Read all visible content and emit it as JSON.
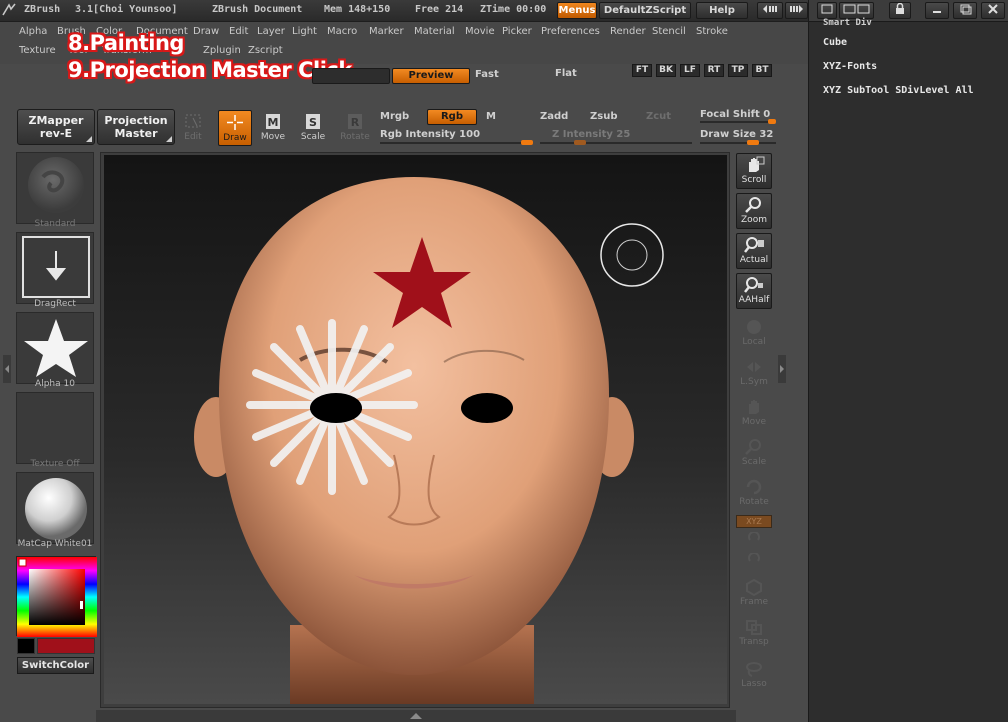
{
  "titlebar": {
    "app": "ZBrush",
    "version_user": "3.1[Choi Younsoo]",
    "document": "ZBrush Document",
    "mem": "Mem 148+150",
    "free": "Free 214",
    "ztime": "ZTime 00:00",
    "menus_btn": "Menus",
    "defaultzscript_btn": "DefaultZScript",
    "help_btn": "Help"
  },
  "menus": {
    "row1": [
      "Alpha",
      "Brush",
      "Color",
      "Document",
      "Draw",
      "Edit",
      "Layer",
      "Light",
      "Macro",
      "Marker",
      "Material",
      "Movie",
      "Picker",
      "Preferences",
      "Render",
      "Stencil",
      "Stroke"
    ],
    "row2": [
      "Texture",
      "Tool",
      "Transform",
      "Zplugin",
      "Zscript"
    ]
  },
  "overlay": {
    "line1": "8.Painting",
    "line2": "9.Projection Master Click"
  },
  "render_bar": {
    "preview": "Preview",
    "fast": "Fast",
    "flat": "Flat"
  },
  "view_buttons": [
    "FT",
    "BK",
    "LF",
    "RT",
    "TP",
    "BT"
  ],
  "toolrow": {
    "zmapper_line1": "ZMapper",
    "zmapper_line2": "rev-E",
    "projection_line1": "Projection",
    "projection_line2": "Master",
    "edit": "Edit",
    "draw": "Draw",
    "move": "Move",
    "scale": "Scale",
    "rotate": "Rotate",
    "mrgb": "Mrgb",
    "rgb": "Rgb",
    "m": "M",
    "rgb_intensity": "Rgb Intensity 100",
    "zadd": "Zadd",
    "zsub": "Zsub",
    "zcut": "Zcut",
    "z_intensity": "Z Intensity 25",
    "focal_shift": "Focal Shift 0",
    "draw_size": "Draw Size 32"
  },
  "shelf": {
    "standard": "Standard",
    "dragrect": "DragRect",
    "alpha": "Alpha 10",
    "texture": "Texture Off",
    "matcap": "MatCap White01",
    "switchcolor": "SwitchColor"
  },
  "right_strip": {
    "scroll": "Scroll",
    "zoom": "Zoom",
    "actual": "Actual",
    "aahalf": "AAHalf",
    "local": "Local",
    "lsym": "L.Sym",
    "move": "Move",
    "scale": "Scale",
    "rotate": "Rotate",
    "xyz": "XYZ",
    "frame": "Frame",
    "transp": "Transp",
    "lasso": "Lasso"
  },
  "tray": {
    "items": [
      "Smart Div",
      "Cube",
      "XYZ-Fonts",
      "XYZ SubTool SDivLevel All"
    ]
  },
  "colors": {
    "accent": "#f28a22",
    "star": "#a0101a",
    "overlay_outline": "#d81818"
  }
}
